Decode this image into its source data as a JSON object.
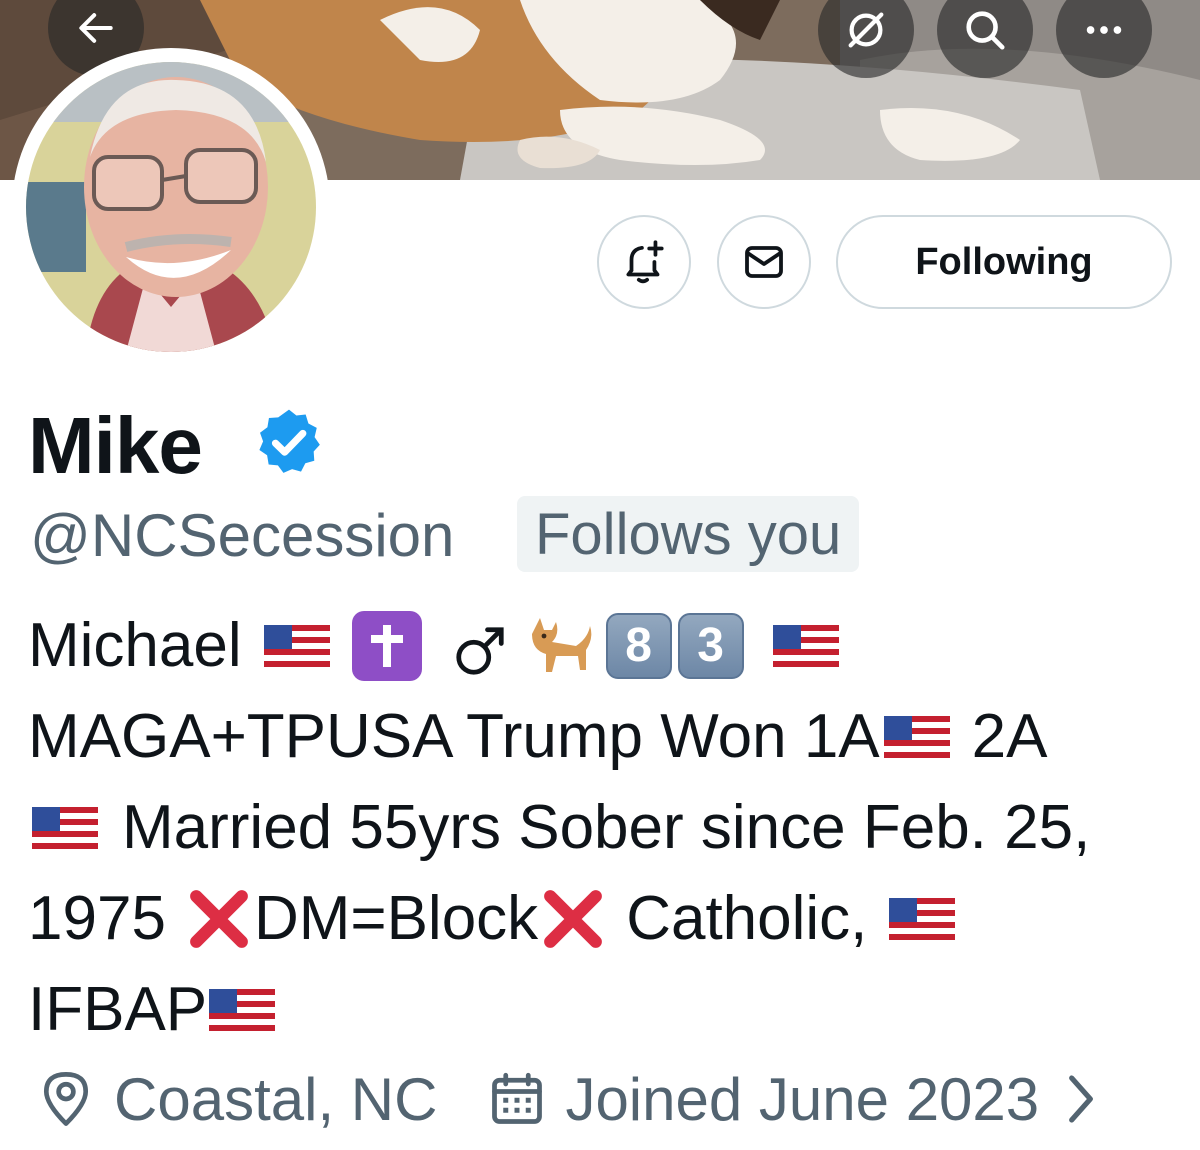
{
  "header": {
    "back_icon": "arrow-left-icon",
    "grok_icon": "slash-circle-icon",
    "search_icon": "search-icon",
    "more_icon": "more-horizontal-icon"
  },
  "actions": {
    "notify_icon": "bell-plus-icon",
    "message_icon": "envelope-icon",
    "following_label": "Following"
  },
  "profile": {
    "display_name": "Mike",
    "verified": true,
    "verified_color": "#1d9bf0",
    "handle": "@NCSecession",
    "follows_you_label": "Follows you"
  },
  "bio": {
    "line1": {
      "name": "Michael",
      "keycaps": [
        "8",
        "3"
      ],
      "emoji": [
        "flag-us",
        "latin-cross",
        "male-sign",
        "dog",
        "keycap-8",
        "keycap-3",
        "flag-us"
      ]
    },
    "line2": {
      "part1": "MAGA+TPUSA Trump Won 1A",
      "part2": "2A"
    },
    "line3": {
      "text": "Married 55yrs Sober since Feb. 25,"
    },
    "line4": {
      "part1": "1975",
      "part2": "DM=Block",
      "part3": "Catholic,"
    },
    "line5": {
      "text": "IFBAP"
    }
  },
  "meta": {
    "location_icon": "location-pin-icon",
    "location": "Coastal, NC",
    "joined_icon": "calendar-icon",
    "joined": "Joined June 2023",
    "chevron_icon": "chevron-right-icon"
  }
}
